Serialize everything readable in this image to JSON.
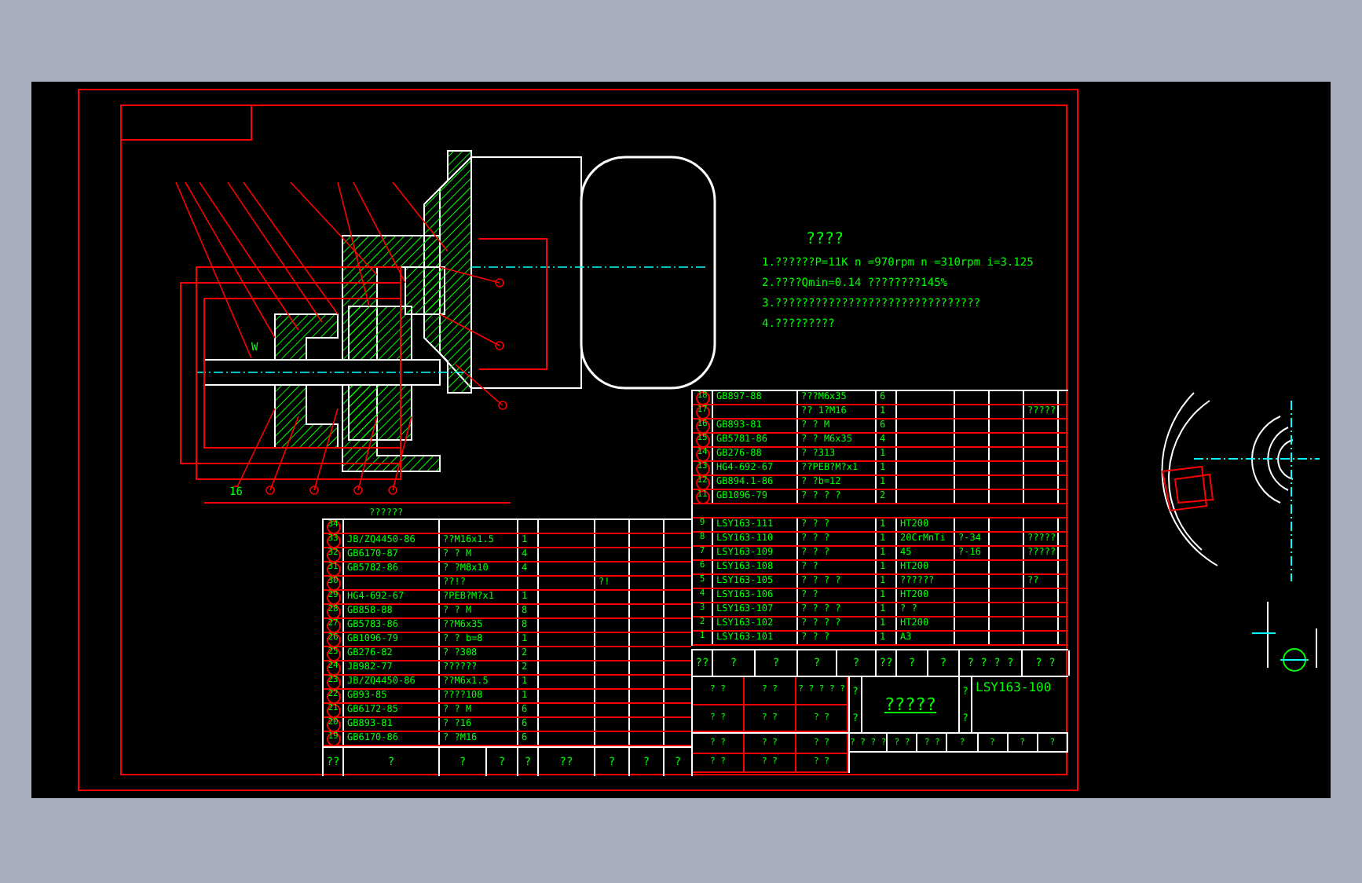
{
  "notes": {
    "title": "????",
    "lines": [
      "1.??????P=11K  n =970rpm  n =310rpm  i=3.125",
      "2.????Qmin=0.14  ????????145%",
      "3.???????????????????????????????",
      "4.?????????"
    ]
  },
  "drawing_labels": [
    {
      "kind": "dim",
      "text": "16"
    },
    {
      "kind": "dim",
      "text": "W"
    },
    {
      "kind": "caption",
      "text": "??????"
    }
  ],
  "parts_list_right": [
    {
      "no": "18",
      "circled": true,
      "code": "GB897-88",
      "name": "???M6x35",
      "qty": "6"
    },
    {
      "no": "17",
      "circled": true,
      "name": "?? 1?M16",
      "qty": "1",
      "note": "?????"
    },
    {
      "no": "16",
      "circled": true,
      "code": "GB893-81",
      "name": "? ? M",
      "qty": "6"
    },
    {
      "no": "15",
      "circled": true,
      "code": "GB5781-86",
      "name": "? ? M6x35",
      "qty": "4"
    },
    {
      "no": "14",
      "circled": true,
      "code": "GB276-88",
      "name": "? ?313",
      "qty": "1"
    },
    {
      "no": "13",
      "circled": true,
      "code": "HG4-692-67",
      "name": "??PEB?M?x1",
      "qty": "1"
    },
    {
      "no": "12",
      "circled": true,
      "code": "GB894.1-86",
      "name": "? ?b=12",
      "qty": "1"
    },
    {
      "no": "11",
      "circled": true,
      "code": "GB1096-79",
      "name": "? ? ? ?",
      "qty": "2"
    },
    {
      "kind": "spacer"
    },
    {
      "no": "9",
      "circled": false,
      "code": "LSY163-111",
      "name": "? ? ?",
      "qty": "1",
      "material": "HT200"
    },
    {
      "no": "8",
      "circled": false,
      "code": "LSY163-110",
      "name": "? ? ?",
      "extra": "?-34",
      "qty": "1",
      "material": "20CrMnTi",
      "note": "?????"
    },
    {
      "no": "7",
      "circled": false,
      "code": "LSY163-109",
      "name": "? ? ?",
      "extra": "?-16",
      "qty": "1",
      "material": "45",
      "note": "?????"
    },
    {
      "no": "6",
      "circled": false,
      "code": "LSY163-108",
      "name": "? ?",
      "qty": "1",
      "material": "HT200"
    },
    {
      "no": "5",
      "circled": false,
      "code": "LSY163-105",
      "name": "? ? ? ?",
      "qty": "1",
      "material": "??????",
      "note": "??"
    },
    {
      "no": "4",
      "circled": false,
      "code": "LSY163-106",
      "name": "? ?",
      "qty": "1",
      "material": "HT200"
    },
    {
      "no": "3",
      "circled": false,
      "code": "LSY163-107",
      "name": "? ? ? ?",
      "qty": "1",
      "material": "? ?"
    },
    {
      "no": "2",
      "circled": false,
      "code": "LSY163-102",
      "name": "? ? ? ?",
      "qty": "1",
      "material": "HT200"
    },
    {
      "no": "1",
      "circled": false,
      "code": "LSY163-101",
      "name": "? ? ?",
      "qty": "1",
      "material": "A3"
    }
  ],
  "parts_list_left": [
    {
      "no": "34",
      "circled": true
    },
    {
      "no": "33",
      "circled": true,
      "code": "JB/ZQ4450-86",
      "name": "??M16x1.5",
      "qty": "1"
    },
    {
      "no": "32",
      "circled": true,
      "code": "GB6170-87",
      "name": "? ? M",
      "qty": "4"
    },
    {
      "no": "31",
      "circled": true,
      "code": "GB5782-86",
      "name": "? ?M8x10",
      "qty": "4"
    },
    {
      "no": "30",
      "circled": true,
      "name": "??!?",
      "extra": "?!"
    },
    {
      "no": "29",
      "circled": true,
      "code": "HG4-692-67",
      "name": "?PEB?M?x1",
      "qty": "1"
    },
    {
      "no": "28",
      "circled": true,
      "code": "GB858-88",
      "name": "? ? M",
      "qty": "8"
    },
    {
      "no": "27",
      "circled": true,
      "code": "GB5783-86",
      "name": "??M6x35",
      "qty": "8"
    },
    {
      "no": "26",
      "circled": true,
      "code": "GB1096-79",
      "name": "? ? b=8",
      "qty": "1"
    },
    {
      "no": "25",
      "circled": true,
      "code": "GB276-82",
      "name": "? ?308",
      "qty": "2"
    },
    {
      "no": "24",
      "circled": true,
      "code": "JB982-77",
      "name": "??????",
      "qty": "2"
    },
    {
      "no": "23",
      "circled": true,
      "code": "JB/ZQ4450-86",
      "name": "??M6x1.5",
      "qty": "1"
    },
    {
      "no": "22",
      "circled": true,
      "code": "GB93-85",
      "name": "????108",
      "qty": "1"
    },
    {
      "no": "21",
      "circled": true,
      "code": "GB6172-85",
      "name": "? ? M",
      "qty": "6"
    },
    {
      "no": "20",
      "circled": true,
      "code": "GB893-81",
      "name": "? ?16",
      "qty": "6"
    },
    {
      "no": "19",
      "circled": true,
      "code": "GB6170-86",
      "name": "? ?M16",
      "qty": "6"
    }
  ],
  "left_footer": [
    "??",
    "?",
    "?",
    "?",
    "?",
    "??",
    "?",
    "?",
    "?"
  ],
  "right_footer": [
    "??",
    "?",
    "?",
    "?",
    "?",
    "??",
    "?",
    "?",
    "? ? ? ?",
    "? ?"
  ],
  "title_block": {
    "title": "?????",
    "drawing_no": "LSY163-100",
    "side_labels": [
      "?",
      "?",
      "?",
      "?"
    ],
    "small_cells": [
      "? ?",
      "? ?",
      "? ? ? ? ?",
      "? ?",
      "? ?",
      "? ?",
      "? ?",
      "? ?",
      "? ?",
      "? ?",
      "? ?",
      "? ?"
    ],
    "bottom_cells": [
      "? ? ? ?",
      "? ?",
      "? ?",
      "?",
      "?",
      "?",
      "?"
    ]
  }
}
